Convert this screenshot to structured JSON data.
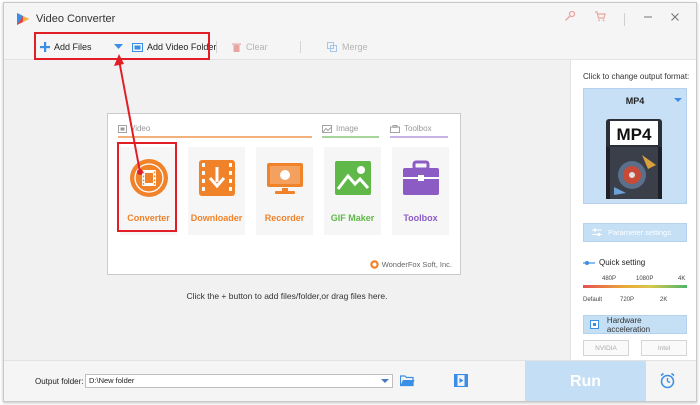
{
  "window": {
    "title": "Video Converter"
  },
  "toolbar": {
    "add_files": "Add Files",
    "add_video_folder": "Add Video Folder",
    "clear": "Clear",
    "merge": "Merge"
  },
  "main": {
    "sections": {
      "video": "Video",
      "image": "Image",
      "toolbox": "Toolbox"
    },
    "tiles": [
      {
        "label": "Converter",
        "color": "#f0822a"
      },
      {
        "label": "Downloader",
        "color": "#f0822a"
      },
      {
        "label": "Recorder",
        "color": "#f0822a"
      },
      {
        "label": "GIF Maker",
        "color": "#5fb848"
      },
      {
        "label": "Toolbox",
        "color": "#8a5cc4"
      }
    ],
    "brand": "WonderFox Soft, Inc.",
    "hint": "Click the + button to add files/folder,or drag files here."
  },
  "panel": {
    "caption": "Click to change output format:",
    "format": "MP4",
    "format_icon_text": "MP4",
    "parameter_settings": "Parameter settings",
    "quick_setting": "Quick setting",
    "quality_top": [
      "480P",
      "1080P",
      "4K"
    ],
    "quality_bottom": [
      "Default",
      "720P",
      "2K"
    ],
    "hardware_acceleration": "Hardware acceleration",
    "gpu": [
      "NVIDIA",
      "Intel"
    ]
  },
  "bottom": {
    "output_label": "Output folder:",
    "output_path": "D:\\New folder",
    "run": "Run"
  },
  "colors": {
    "accent": "#3b8ee5",
    "highlight": "#e11e26",
    "orange": "#f0822a",
    "green": "#5fb848",
    "purple": "#8a5cc4"
  }
}
